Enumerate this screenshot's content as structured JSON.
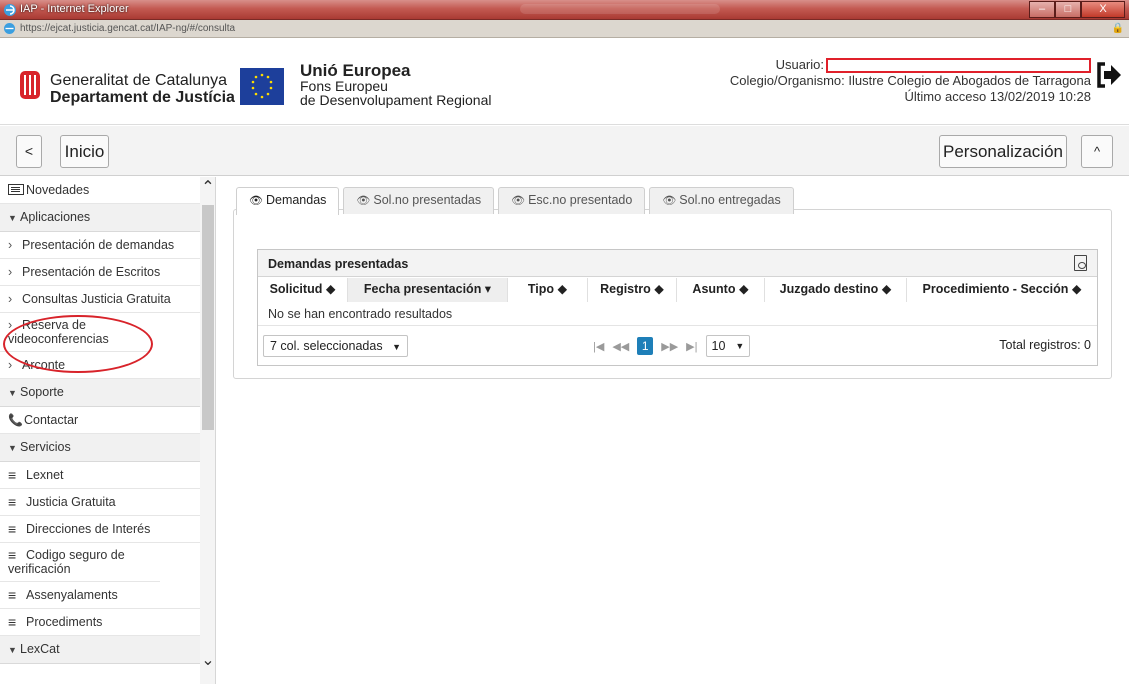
{
  "browser": {
    "title": "IAP - Internet Explorer",
    "url": "https://ejcat.justicia.gencat.cat/IAP-ng/#/consulta",
    "window_buttons": [
      "–",
      "□",
      "X"
    ]
  },
  "header": {
    "gencat_line1": "Generalitat de Catalunya",
    "gencat_line2": "Departament de Justícia",
    "eu_title": "Unió Europea",
    "eu_line2": "Fons Europeu",
    "eu_line3": "de Desenvolupament Regional",
    "user_label": "Usuario:",
    "organismo": "Colegio/Organismo: Ilustre Colegio de Abogados de Tarragona",
    "last_access": "Último acceso 13/02/2019 10:28"
  },
  "toolbar": {
    "back_label": "<",
    "inicio_label": "Inicio",
    "personalizacion_label": "Personalización",
    "up_label": "^"
  },
  "sidebar": {
    "novedades": "Novedades",
    "aplicaciones": "Aplicaciones",
    "app_items": [
      "Presentación de demandas",
      "Presentación de Escritos",
      "Consultas Justicia Gratuita",
      "Reserva de videoconferencias",
      "Arconte"
    ],
    "soporte": "Soporte",
    "contactar": "Contactar",
    "servicios": "Servicios",
    "serv_items": [
      "Lexnet",
      "Justicia Gratuita",
      "Direcciones de Interés",
      "Codigo seguro de verificación",
      "Assenyalaments",
      "Procediments"
    ],
    "lexcat": "LexCat"
  },
  "tabs": [
    "Demandas",
    "Sol.no presentadas",
    "Esc.no presentado",
    "Sol.no entregadas"
  ],
  "grid": {
    "title": "Demandas presentadas",
    "columns": [
      "Solicitud ◆",
      "Fecha presentación ▾",
      "Tipo ◆",
      "Registro ◆",
      "Asunto ◆",
      "Juzgado destino ◆",
      "Procedimiento - Sección ◆"
    ],
    "empty_message": "No se han encontrado resultados",
    "columns_selected": "7 col. seleccionadas",
    "current_page": "1",
    "page_size": "10",
    "total": "Total registros: 0"
  },
  "colors": {
    "accent_blue": "#1e7fb8",
    "annotation_red": "#d8232a",
    "gencat_red": "#d8232a",
    "eu_blue": "#1d3f9b"
  }
}
